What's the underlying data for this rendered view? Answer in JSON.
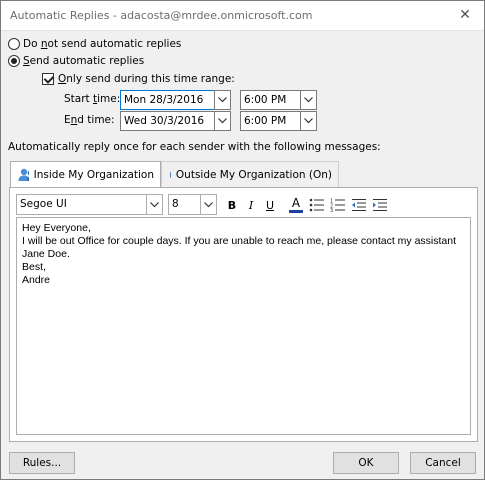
{
  "window": {
    "title": "Automatic Replies - adacosta@mrdee.onmicrosoft.com",
    "close_glyph": "✕"
  },
  "options": {
    "do_not_send": {
      "label_pre": "Do ",
      "label_ul": "n",
      "label_post": "ot send automatic replies",
      "selected": false
    },
    "send": {
      "label_pre": "",
      "label_ul": "S",
      "label_post": "end automatic replies",
      "selected": true
    },
    "only_range": {
      "label_pre": "",
      "label_ul": "O",
      "label_post": "nly send during this time range:",
      "checked": true
    }
  },
  "time_range": {
    "start": {
      "label_pre": "Start ",
      "label_ul": "t",
      "label_post": "ime:",
      "date": "Mon 28/3/2016",
      "time": "6:00 PM"
    },
    "end": {
      "label_pre": "E",
      "label_ul": "n",
      "label_post": "d time:",
      "date": "Wed 30/3/2016",
      "time": "6:00 PM"
    }
  },
  "once_text": "Automatically reply once for each sender with the following messages:",
  "tabs": [
    {
      "label": "Inside My Organization",
      "icon": "people-icon",
      "active": true
    },
    {
      "label": "Outside My Organization (On)",
      "icon": "globe-icon",
      "active": false
    }
  ],
  "toolbar": {
    "font": "Segoe UI",
    "size": "8",
    "bold": "B",
    "italic": "I",
    "underline": "U",
    "font_color": "A",
    "color_bar": "#1f3f9f"
  },
  "message": {
    "lines": [
      "Hey Everyone,",
      "",
      "I will be out Office for couple days. If you are unable to reach me, please contact my assistant Jane Doe.",
      "",
      "Best,",
      "Andre"
    ]
  },
  "buttons": {
    "rules": "Rules...",
    "ok": "OK",
    "cancel": "Cancel"
  }
}
